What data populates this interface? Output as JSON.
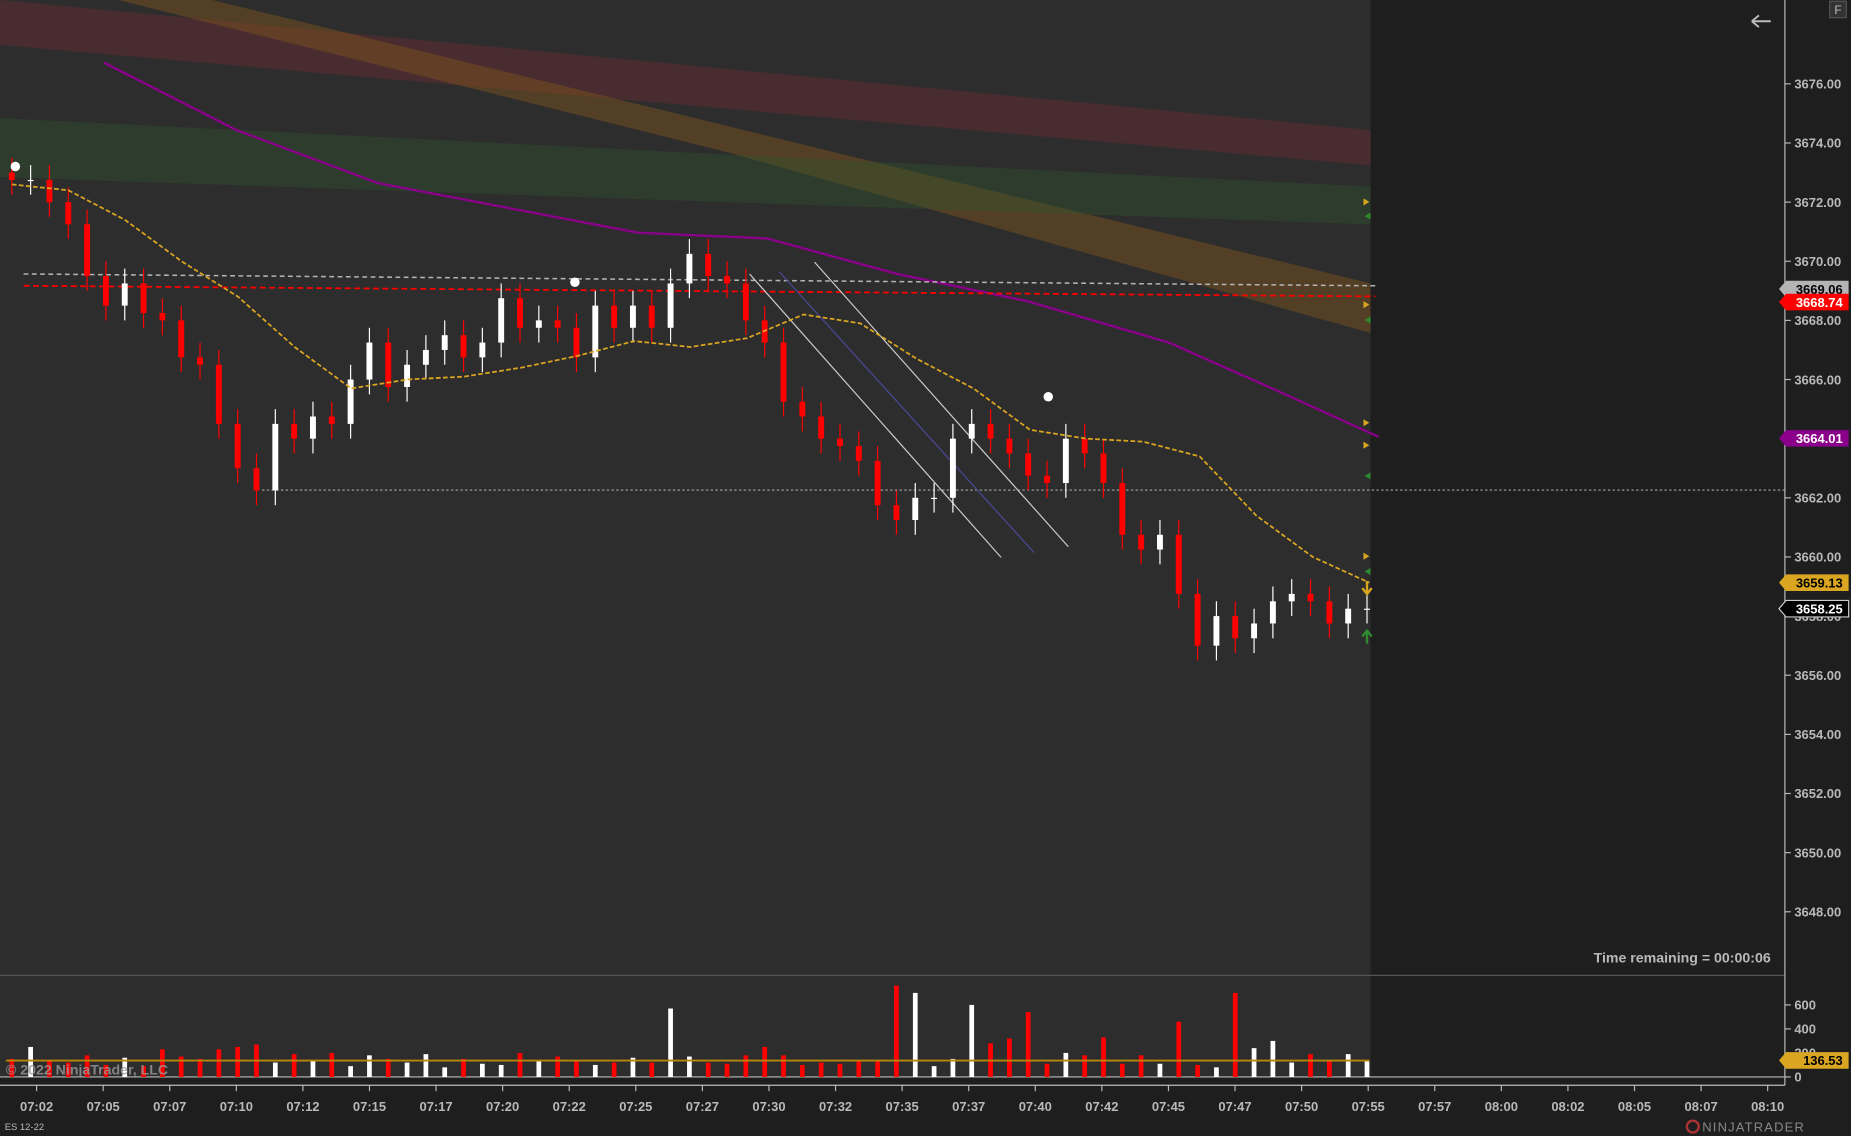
{
  "instrument": "ES 12-22",
  "copyright": "© 2022 NinjaTrader, LLC",
  "brand": "NINJATRADER",
  "time_remaining": "Time remaining = 00:00:06",
  "toolbar": {
    "f_button": "F",
    "back_icon": "arrow-left-icon"
  },
  "price_axis": {
    "ticks": [
      "3676.00",
      "3674.00",
      "3672.00",
      "3670.00",
      "3668.00",
      "3666.00",
      "3664.00",
      "3662.00",
      "3660.00",
      "3658.00",
      "3656.00",
      "3654.00",
      "3652.00",
      "3650.00",
      "3648.00"
    ],
    "tick_values": [
      3676,
      3674,
      3672,
      3670,
      3668,
      3666,
      3664,
      3662,
      3660,
      3658,
      3656,
      3654,
      3652,
      3650,
      3648
    ]
  },
  "price_markers": [
    {
      "label": "3669.06",
      "value": 3669.06,
      "bg": "#b4b4b4",
      "fg": "#000000"
    },
    {
      "label": "3668.74",
      "value": 3668.74,
      "bg": "#ff0000",
      "fg": "#ffffff"
    },
    {
      "label": "3664.01",
      "value": 3664.01,
      "bg": "#8b008b",
      "fg": "#ffffff"
    },
    {
      "label": "3659.13",
      "value": 3659.13,
      "bg": "#daa520",
      "fg": "#000000"
    },
    {
      "label": "3658.25",
      "value": 3658.25,
      "bg": "#000000",
      "fg": "#ffffff"
    }
  ],
  "volume_axis": {
    "ticks": [
      "600",
      "400",
      "200",
      "0"
    ],
    "tick_values": [
      600,
      400,
      200,
      0
    ]
  },
  "volume_marker": {
    "label": "136.53",
    "value": 136.53,
    "bg": "#daa520"
  },
  "time_axis": [
    "07:02",
    "07:05",
    "07:07",
    "07:10",
    "07:12",
    "07:15",
    "07:17",
    "07:20",
    "07:22",
    "07:25",
    "07:27",
    "07:30",
    "07:32",
    "07:35",
    "07:37",
    "07:40",
    "07:42",
    "07:45",
    "07:47",
    "07:50",
    "07:55",
    "07:57",
    "08:00",
    "08:02",
    "08:05",
    "08:07",
    "08:10"
  ],
  "colors": {
    "up": "#ffffff",
    "down": "#ff0000",
    "ema": "#daa520",
    "sma": "#8b008b",
    "bg_data": "#2d2d2d",
    "bg": "#1e1e1e"
  },
  "chart_data": {
    "type": "candlestick",
    "closes": [
      3672.75,
      3672.75,
      3672,
      3671.25,
      3669.5,
      3668.5,
      3669.25,
      3668.25,
      3668,
      3666.75,
      3666.5,
      3664.5,
      3663,
      3662.25,
      3664.5,
      3664,
      3664.75,
      3664.5,
      3666,
      3667.25,
      3665.75,
      3666.5,
      3667,
      3667.5,
      3666.75,
      3667.25,
      3668.75,
      3667.75,
      3668,
      3667.75,
      3666.75,
      3668.5,
      3667.75,
      3668.5,
      3667.75,
      3669.25,
      3670.25,
      3669.5,
      3669.25,
      3668,
      3667.25,
      3665.25,
      3664.75,
      3664,
      3663.75,
      3663.25,
      3661.75,
      3661.25,
      3662,
      3662,
      3664,
      3664.5,
      3664,
      3663.5,
      3662.75,
      3662.5,
      3664,
      3663.5,
      3662.5,
      3660.75,
      3660.25,
      3660.75,
      3658.75,
      3657,
      3658,
      3657.25,
      3657.75,
      3658.5,
      3658.75,
      3658.5,
      3657.75,
      3658.25,
      3658.25
    ],
    "volumes": [
      150,
      250,
      140,
      120,
      180,
      100,
      160,
      90,
      230,
      170,
      150,
      230,
      250,
      270,
      120,
      190,
      140,
      200,
      90,
      180,
      150,
      120,
      190,
      80,
      150,
      110,
      100,
      200,
      140,
      170,
      130,
      100,
      120,
      160,
      120,
      570,
      170,
      120,
      110,
      180,
      250,
      180,
      100,
      120,
      110,
      140,
      130,
      760,
      700,
      90,
      150,
      600,
      280,
      320,
      540,
      110,
      200,
      180,
      330,
      110,
      180,
      110,
      460,
      100,
      80,
      700,
      240,
      300,
      120,
      190,
      130,
      190,
      130
    ],
    "ema": [
      3672.6,
      3672.4,
      3671.4,
      3670,
      3668.8,
      3667.1,
      3665.7,
      3666,
      3666.1,
      3666.4,
      3666.8,
      3667.3,
      3667.1,
      3667.4,
      3668.2,
      3667.9,
      3666.7,
      3665.7,
      3664.3,
      3664,
      3663.9,
      3663.4,
      3661.4,
      3660,
      3659.13
    ],
    "ylim": [
      3646.5,
      3678.5
    ],
    "vol_ylim": [
      0,
      800
    ],
    "last_price": 3658.25
  }
}
